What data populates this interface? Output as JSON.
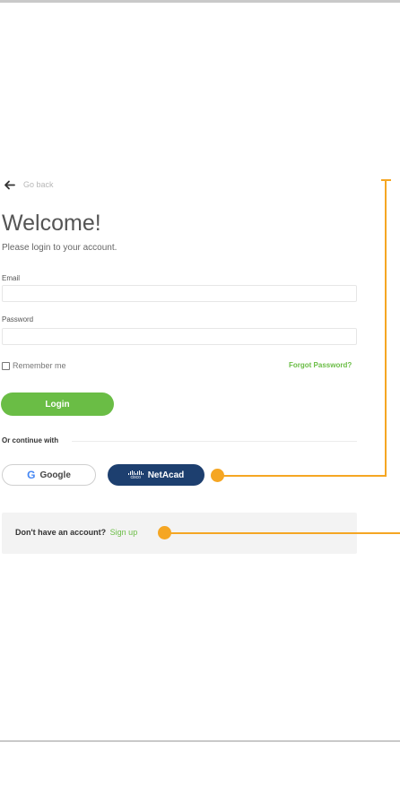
{
  "nav": {
    "back_label": "Go back",
    "back_icon": "arrow-left-icon"
  },
  "header": {
    "title": "Welcome!",
    "subtitle": "Please login to your account."
  },
  "form": {
    "email_label": "Email",
    "email_value": "",
    "password_label": "Password",
    "password_value": "",
    "remember_label": "Remember me",
    "remember_checked": false,
    "forgot_label": "Forgot Password?",
    "login_label": "Login"
  },
  "social": {
    "continue_label": "Or continue with",
    "google_label": "Google",
    "google_icon": "google-g-icon",
    "netacad_label": "NetAcad",
    "netacad_logo_text": "cisco"
  },
  "signup": {
    "prompt": "Don't have an account?",
    "link_label": "Sign up"
  },
  "colors": {
    "accent_green": "#6abd45",
    "netacad_navy": "#1d3f6f",
    "callout_orange": "#f5a623",
    "muted_text": "#b7b7b7"
  }
}
